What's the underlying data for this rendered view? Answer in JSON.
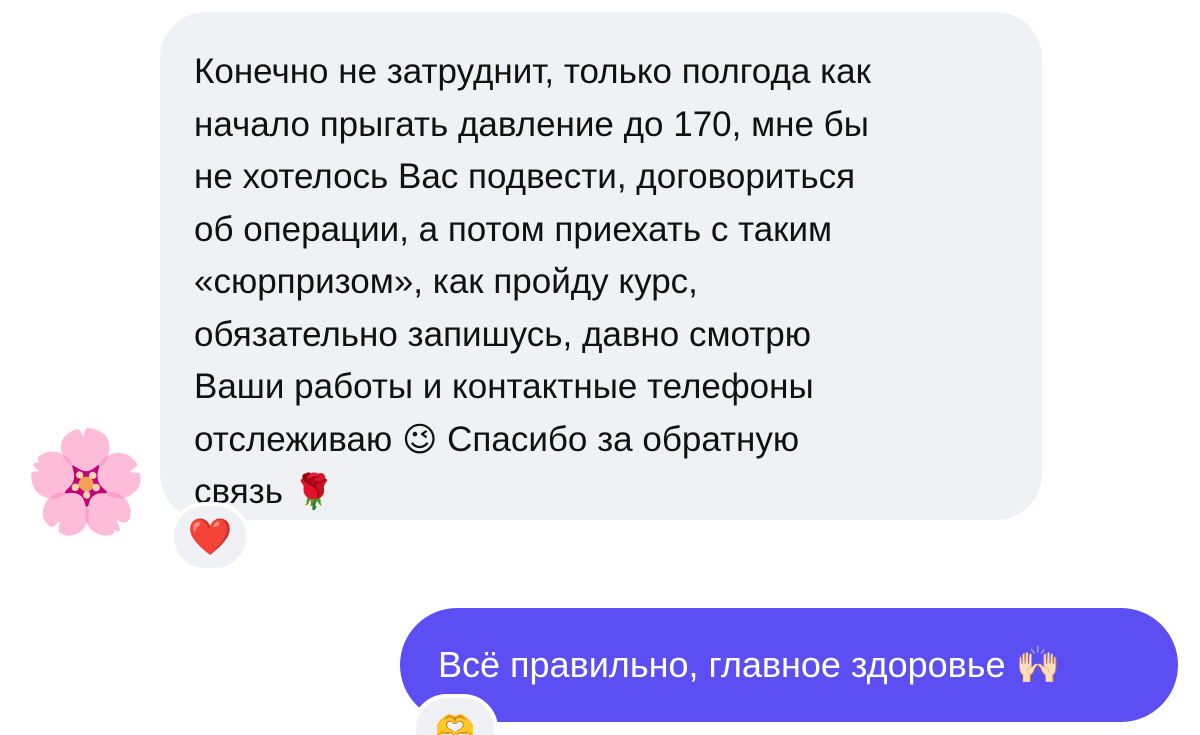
{
  "incoming": {
    "avatar_icon": "cherry-blossom-icon",
    "avatar_glyph": "🌸",
    "lines": [
      "Конечно не затруднит, только полгода как",
      "начало прыгать давление до 170, мне бы",
      "не хотелось Вас подвести, договориться",
      "об операции, а потом приехать с таким",
      "«сюрпризом», как пройду курс,",
      "обязательно запишусь, давно смотрю",
      "Ваши работы и контактные телефоны"
    ],
    "line8_start": "отслеживаю",
    "wink_emoji": "😉",
    "line8_end": "Спасибо за обратную",
    "line9_start": "связь",
    "rose_emoji": "🌹",
    "reaction": "❤️"
  },
  "outgoing": {
    "text": "Всё правильно, главное здоровье",
    "emoji": "🙌🏻",
    "reaction": "🫶"
  },
  "colors": {
    "incoming_bubble": "#f0f1f4",
    "outgoing_bubble": "#5b4ef2",
    "incoming_text": "#111111",
    "outgoing_text": "#ffffff"
  }
}
